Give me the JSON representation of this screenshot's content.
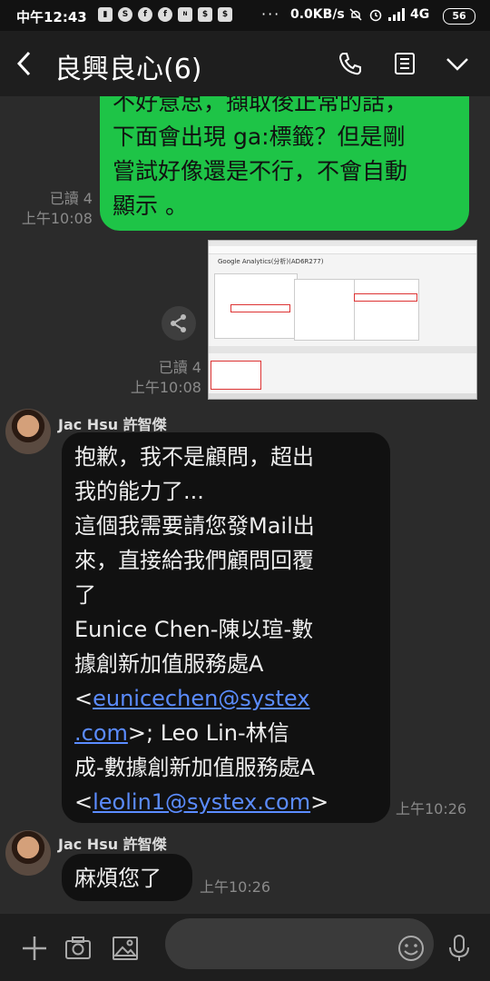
{
  "status_bar": {
    "time": "中午12:43",
    "net_speed": "0.0KB/s",
    "network": "4G",
    "battery": "56"
  },
  "header": {
    "title": "良興良心(6)"
  },
  "messages": {
    "outgoing_text": [
      "不好意思，擷取後正常的話，",
      "下面會出現 ga:標籤？但是剛",
      "嘗試好像還是不行，不會自動",
      "顯示 。"
    ],
    "outgoing_read": "已讀 4",
    "outgoing_time": "上午10:08",
    "image_read": "已讀 4",
    "image_time": "上午10:08",
    "screenshot_title": "Google Analytics(分析)(AD6R277)",
    "sender_name": "Jac Hsu 許智傑",
    "reply1_lines": [
      "抱歉，我不是顧問，超出",
      "我的能力了...",
      "這個我需要請您發Mail出",
      "來，直接給我們顧問回覆",
      "了",
      "Eunice Chen-陳以瑄-數",
      "據創新加值服務處A"
    ],
    "reply1_link1_prefix": "<",
    "reply1_link1_a": "eunicechen@systex",
    "reply1_link1_b": ".com",
    "reply1_mid": ">; Leo Lin-林信",
    "reply1_line_after": "成-數據創新加值服務處A",
    "reply1_link2_prefix": "<",
    "reply1_link2": "leolin1@systex.com",
    "reply1_link2_suffix": ">",
    "reply1_time": "上午10:26",
    "sender_name_2": "Jac Hsu 許智傑",
    "reply2": "麻煩您了",
    "reply2_time": "上午10:26"
  },
  "icons": {
    "back": "chevron-left-icon",
    "call": "phone-icon",
    "notes": "notes-icon",
    "menu": "chevron-down-icon",
    "add": "plus-icon",
    "camera": "camera-icon",
    "image": "image-icon",
    "emoji": "emoji-icon",
    "mic": "microphone-icon"
  },
  "colors": {
    "outgoing_bubble": "#1ec447",
    "incoming_bubble": "#111111",
    "link": "#5b8cff",
    "background": "#2b2b2b"
  }
}
